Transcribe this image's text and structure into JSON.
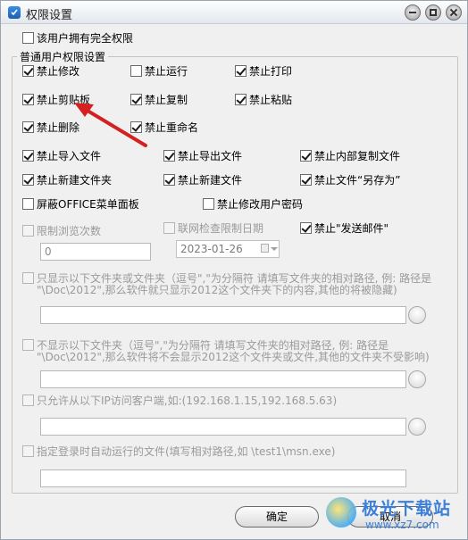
{
  "window": {
    "title": "权限设置",
    "icon": "shield-icon"
  },
  "full_rights": {
    "label": "该用户拥有完全权限",
    "checked": false
  },
  "group": {
    "title": "普通用户权限设置"
  },
  "perm_rows": [
    {
      "name": "forbid-modify",
      "label": "禁止修改",
      "checked": true
    },
    {
      "name": "forbid-run",
      "label": "禁止运行",
      "checked": false
    },
    {
      "name": "forbid-print",
      "label": "禁止打印",
      "checked": true
    },
    {
      "name": "forbid-clipboard",
      "label": "禁止剪贴板",
      "checked": true
    },
    {
      "name": "forbid-copy",
      "label": "禁止复制",
      "checked": true
    },
    {
      "name": "forbid-paste",
      "label": "禁止粘贴",
      "checked": true
    },
    {
      "name": "forbid-delete",
      "label": "禁止删除",
      "checked": true
    },
    {
      "name": "forbid-rename",
      "label": "禁止重命名",
      "checked": true
    },
    {
      "name": "forbid-import",
      "label": "禁止导入文件",
      "checked": true
    },
    {
      "name": "forbid-export",
      "label": "禁止导出文件",
      "checked": true
    },
    {
      "name": "forbid-internal-copy",
      "label": "禁止内部复制文件",
      "checked": true
    },
    {
      "name": "forbid-new-folder",
      "label": "禁止新建文件夹",
      "checked": true
    },
    {
      "name": "forbid-new-file",
      "label": "禁止新建文件",
      "checked": true
    },
    {
      "name": "forbid-save-as",
      "label": "禁止文件“另存为”",
      "checked": true
    },
    {
      "name": "hide-office-menu",
      "label": "屏蔽OFFICE菜单面板",
      "checked": false
    },
    {
      "name": "forbid-change-password",
      "label": "禁止修改用户密码",
      "checked": false
    },
    {
      "name": "limit-browse-count",
      "label": "限制浏览次数",
      "checked": false
    },
    {
      "name": "online-check-date",
      "label": "联网检查限制日期",
      "checked": false
    },
    {
      "name": "forbid-send-mail",
      "label": "禁止\"发送邮件\"",
      "checked": true
    }
  ],
  "browse_count": {
    "value": "0"
  },
  "limit_date": {
    "value": "2023-01-26"
  },
  "only_show": {
    "label": "只显示以下文件夹或文件夹（逗号\",\"为分隔符 请填写文件夹的相对路径, 例: 路径是",
    "line2": "\"\\Doc\\2012\",那么软件就只显示2012这个文件夹下的内容,其他的将被隐藏)",
    "checked": false,
    "value": ""
  },
  "not_show": {
    "label": "不显示以下文件夹（逗号\",\"为分隔符 请填写文件夹的相对路径, 例: 路径是",
    "line2": "\"\\Doc\\2012\",那么软件将不会显示2012这个文件夹或文件,其他的文件夹不受影响)",
    "checked": false,
    "value": ""
  },
  "ip_allow": {
    "label": "只允许从以下IP访问客户端,如:(192.168.1.15,192.168.5.63)",
    "checked": false,
    "value": ""
  },
  "auto_run": {
    "label": "指定登录时自动运行的文件(填写相对路径,如 \\test1\\msn.exe)",
    "checked": false,
    "value": ""
  },
  "buttons": {
    "ok": "确定",
    "cancel": "取消"
  },
  "watermark": {
    "title": "极光下载站",
    "site": "www.xz7.com"
  },
  "colors": {
    "arrow": "#d42020",
    "watermark": "#3b7fd8"
  }
}
